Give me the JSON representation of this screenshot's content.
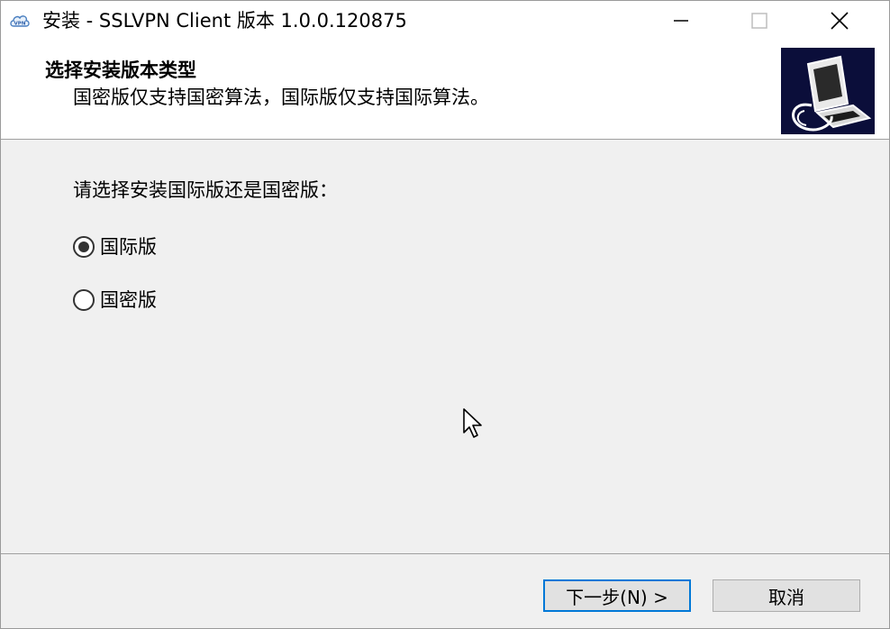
{
  "window": {
    "title": "安装 - SSLVPN Client 版本 1.0.0.120875",
    "app_icon": "vpn-cloud-icon",
    "controls": {
      "minimize_icon": "minimize-icon",
      "maximize_icon": "maximize-icon",
      "close_icon": "close-icon"
    }
  },
  "header": {
    "title": "选择安装版本类型",
    "subtitle": "国密版仅支持国密算法，国际版仅支持国际算法。",
    "logo_icon": "computer-install-icon"
  },
  "content": {
    "prompt": "请选择安装国际版还是国密版：",
    "options": [
      {
        "label": "国际版",
        "selected": true
      },
      {
        "label": "国密版",
        "selected": false
      }
    ]
  },
  "footer": {
    "next_label": "下一步(N) >",
    "cancel_label": "取消"
  },
  "colors": {
    "accent": "#0078d7",
    "header_bg": "#ffffff",
    "body_bg": "#f0f0f0",
    "logo_bg": "#0b0e3a"
  }
}
